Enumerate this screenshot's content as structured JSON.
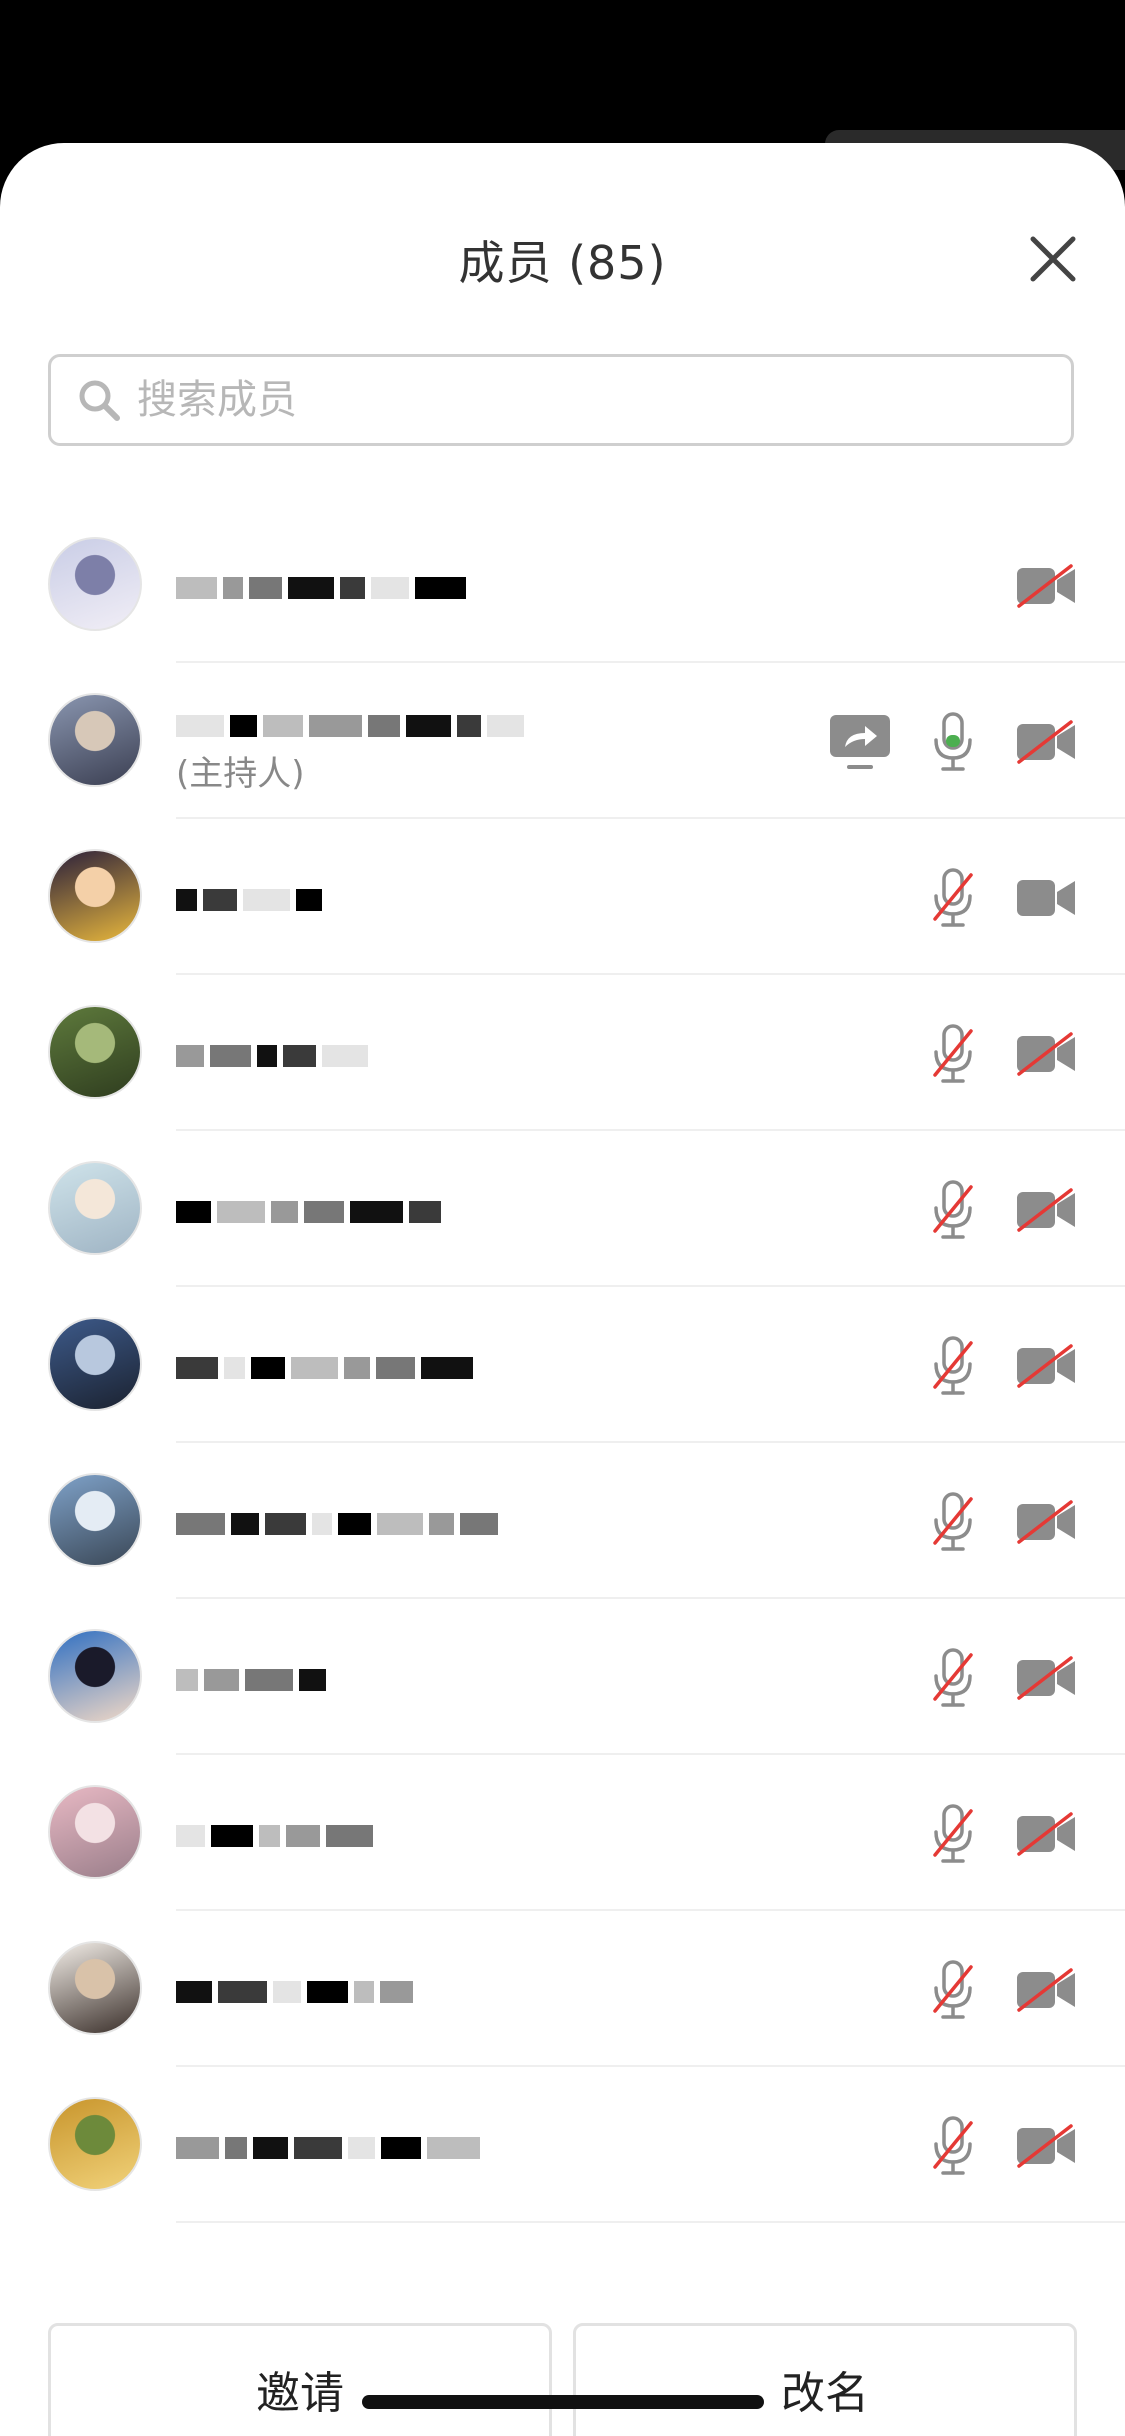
{
  "header": {
    "title": "成员 (85)"
  },
  "search": {
    "placeholder": "搜索成员",
    "value": ""
  },
  "members": [
    {
      "name": "",
      "role": "",
      "avatar": "couple-wedding-photo",
      "icons": [
        "camera-off"
      ]
    },
    {
      "name": "",
      "role": "(主持人)",
      "avatar": "family-photo",
      "icons": [
        "screen-share",
        "mic-on",
        "camera-off"
      ]
    },
    {
      "name": "",
      "role": "",
      "avatar": "cartoon-girl",
      "icons": [
        "mic-off",
        "camera-on"
      ]
    },
    {
      "name": "",
      "role": "",
      "avatar": "forest-path",
      "icons": [
        "mic-off",
        "camera-off"
      ]
    },
    {
      "name": "",
      "role": "",
      "avatar": "anime-girl",
      "icons": [
        "mic-off",
        "camera-off"
      ]
    },
    {
      "name": "",
      "role": "",
      "avatar": "seaside-silhouette",
      "icons": [
        "mic-off",
        "camera-off"
      ]
    },
    {
      "name": "",
      "role": "",
      "avatar": "fighter-jet",
      "icons": [
        "mic-off",
        "camera-off"
      ]
    },
    {
      "name": "",
      "role": "",
      "avatar": "portrait-suit",
      "icons": [
        "mic-off",
        "camera-off"
      ]
    },
    {
      "name": "",
      "role": "",
      "avatar": "collage-photos",
      "icons": [
        "mic-off",
        "camera-off"
      ]
    },
    {
      "name": "",
      "role": "",
      "avatar": "bride-groom",
      "icons": [
        "mic-off",
        "camera-off"
      ]
    },
    {
      "name": "",
      "role": "",
      "avatar": "autumn-trees",
      "icons": [
        "mic-off",
        "camera-off"
      ]
    }
  ],
  "footer": {
    "invite_label": "邀请",
    "rename_label": "改名"
  },
  "colors": {
    "muted_red": "#e53935",
    "icon_grey": "#8c8c8c",
    "mic_green": "#4caf50"
  }
}
